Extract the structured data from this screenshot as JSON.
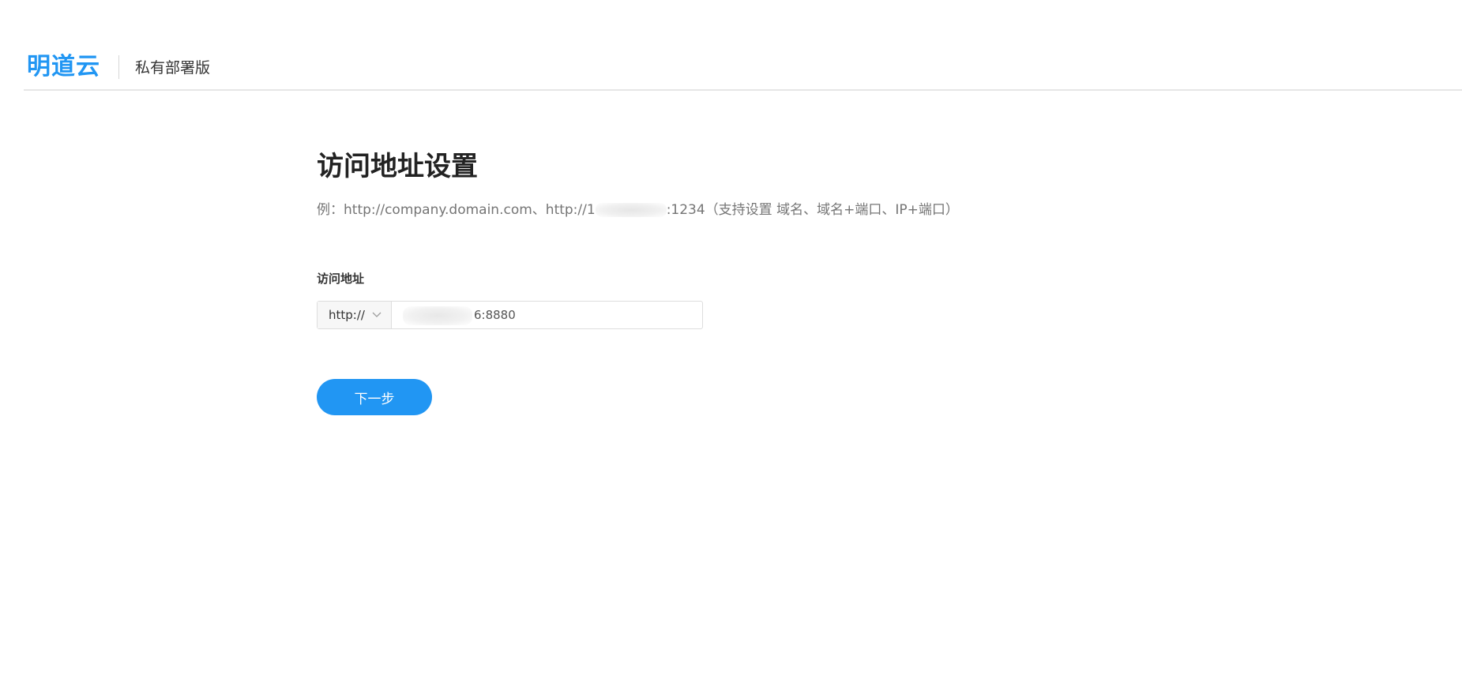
{
  "header": {
    "brand": "明道云",
    "edition": "私有部署版"
  },
  "main": {
    "title": "访问地址设置",
    "hint_prefix": "例：http://company.domain.com、http://1",
    "hint_suffix": ":1234（支持设置 域名、域名+端口、IP+端口）",
    "field_label": "访问地址",
    "protocol": "http://",
    "address_visible": "6:8880",
    "next_button": "下一步"
  },
  "colors": {
    "accent": "#2196f3"
  },
  "icons": {
    "protocol_dropdown": "chevron-down-icon"
  }
}
